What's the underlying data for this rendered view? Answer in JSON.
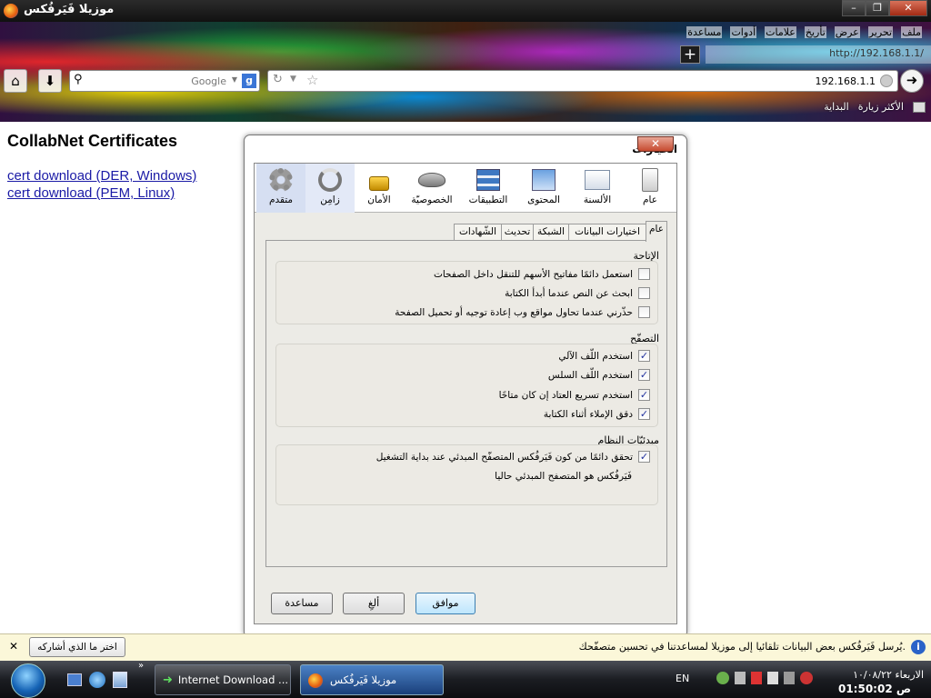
{
  "window": {
    "title": "موزيلا فَيَرفُكس",
    "min_glyph": "–",
    "max_glyph": "❐",
    "close_glyph": "✕"
  },
  "menubar": [
    "ملف",
    "تحرير",
    "عرض",
    "تأريخ",
    "علامات",
    "أدوات",
    "مساعدة"
  ],
  "tabstrip": {
    "text": "http://192.168.1.1/"
  },
  "search": {
    "placeholder": "Google",
    "engine_badge": "g"
  },
  "url": {
    "value": "192.168.1.1"
  },
  "bookmarks": [
    "الأكثر زيارة",
    "البداية"
  ],
  "page": {
    "title": "CollabNet Certificates",
    "links": [
      "cert download (DER, Windows)",
      "cert download (PEM, Linux)"
    ]
  },
  "dialog": {
    "title": "الخيارات",
    "panes": [
      {
        "label": "عام",
        "icon": "general-icon"
      },
      {
        "label": "الألسنة",
        "icon": "tabs-icon"
      },
      {
        "label": "المحتوى",
        "icon": "content-icon"
      },
      {
        "label": "التطبيقات",
        "icon": "applications-icon"
      },
      {
        "label": "الخصوصيّة",
        "icon": "privacy-mask-icon"
      },
      {
        "label": "الأمان",
        "icon": "lock-icon"
      },
      {
        "label": "زامِن",
        "icon": "sync-icon"
      },
      {
        "label": "متقدم",
        "icon": "gear-icon"
      }
    ],
    "tabs": [
      "عام",
      "اختيارات البيانات",
      "الشبكة",
      "تحديث",
      "الشّهادات"
    ],
    "groups": [
      {
        "title": "الإتاحة",
        "items": [
          {
            "label": "استعمل دائمًا مفاتيح الأسهم للتنقل داخل الصفحات",
            "checked": false
          },
          {
            "label": "ابحث عن النص عندما أبدأ الكتابة",
            "checked": false
          },
          {
            "label": "حذّرني عندما تحاول مواقع وب إعادة توجيه أو تحميل الصفحة",
            "checked": false
          }
        ]
      },
      {
        "title": "التصفّح",
        "items": [
          {
            "label": "استخدم اللّف الآلي",
            "checked": true
          },
          {
            "label": "استخدم اللّف السلس",
            "checked": true
          },
          {
            "label": "استخدم تسريع العتاد إن كان متاحًا",
            "checked": true
          },
          {
            "label": "دقق الإملاء أثناء الكتابة",
            "checked": true
          }
        ]
      },
      {
        "title": "مبدئيّات النظام",
        "items": [
          {
            "label": "تحقق دائمًا من كون فَيَرفُكس المتصفّح المبدئي عند بداية التشغيل",
            "checked": true
          }
        ],
        "note": "فَيَرفُكس هو المتصفح المبدئي حاليا"
      }
    ],
    "buttons": {
      "ok": "موافق",
      "cancel": "ألغِ",
      "help": "مساعدة"
    }
  },
  "notification": {
    "text": "يُرسل فَيَرفُكس بعض البيانات تلقائيا إلى موزيلا لمساعدتنا في تحسين متصفّحك.",
    "button": "اختر ما الذي أشاركه",
    "close": "✕"
  },
  "taskbar": {
    "tasks": [
      "Internet Download ...",
      "موزيلا فَيَرفُكس"
    ],
    "lang": "EN",
    "clock_day": "الاربعاء ١٠/٠٨/٢٢",
    "clock_time": "ص 01:50:02"
  }
}
